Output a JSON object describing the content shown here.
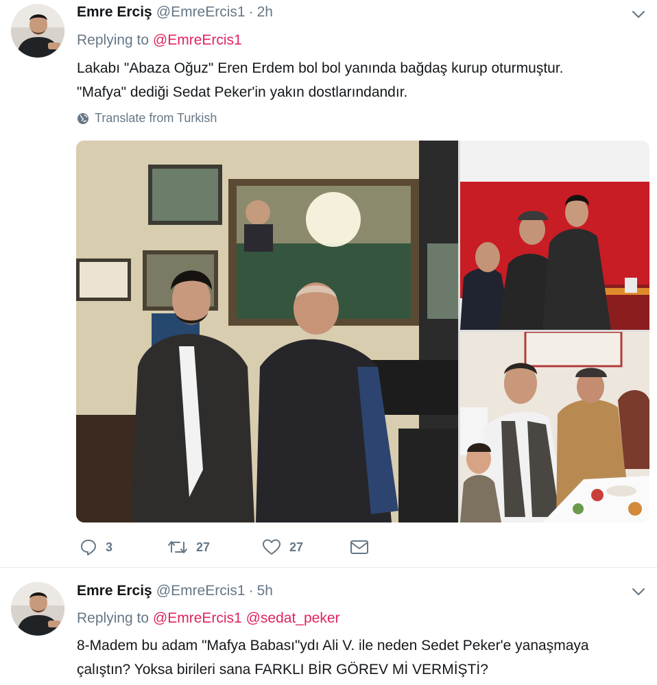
{
  "tweets": [
    {
      "fullname": "Emre Erciş",
      "screenname": "@EmreErcis1",
      "separator": "·",
      "time": "2h",
      "replying_to_label": "Replying to",
      "replying_to": [
        "@EmreErcis1"
      ],
      "text_lines": [
        "Lakabı \"Abaza Oğuz\" Eren Erdem bol bol yanında bağdaş kurup oturmuştur.",
        "\"Mafya\" dediği Sedat Peker'in yakın dostlarındandır."
      ],
      "translate_label": "Translate from Turkish",
      "actions": {
        "replies": "3",
        "retweets": "27",
        "likes": "27"
      },
      "icons": [
        "chevron-down-icon",
        "globe-icon",
        "reply-icon",
        "retweet-icon",
        "heart-icon",
        "mail-icon"
      ]
    },
    {
      "fullname": "Emre Erciş",
      "screenname": "@EmreErcis1",
      "separator": "·",
      "time": "5h",
      "replying_to_label": "Replying to",
      "replying_to": [
        "@EmreErcis1",
        "@sedat_peker"
      ],
      "text_lines": [
        "8-Madem bu adam \"Mafya Babası\"ydı Ali V. ile neden Sedet Peker'e yanaşmaya",
        "çalıştın? Yoksa birileri sana FARKLI BİR GÖREV Mİ VERMİŞTİ?"
      ]
    }
  ],
  "colors": {
    "accent": "#e0245e",
    "muted": "#657786",
    "text": "#14171a",
    "divider": "#e6ecf0"
  }
}
